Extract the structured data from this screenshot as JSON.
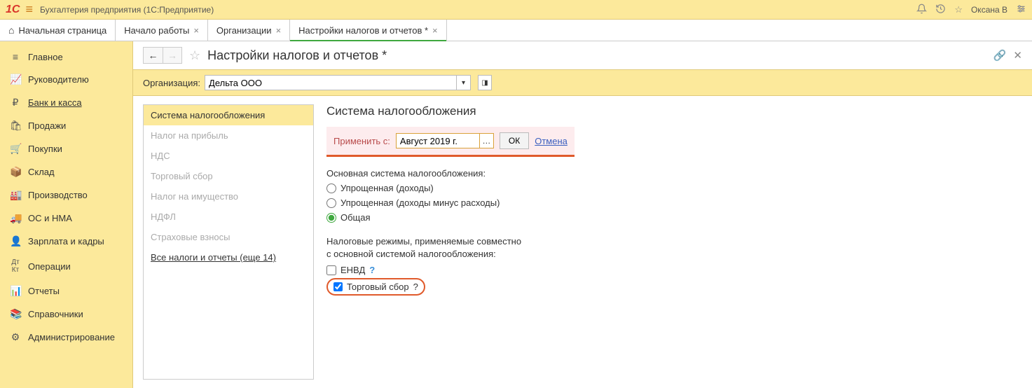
{
  "titlebar": {
    "logo": "1C",
    "title": "Бухгалтерия предприятия  (1С:Предприятие)",
    "user": "Оксана В"
  },
  "tabs": {
    "home": "Начальная страница",
    "t1": "Начало работы",
    "t2": "Организации",
    "t3": "Настройки налогов и отчетов *"
  },
  "sidebar": {
    "items": [
      "Главное",
      "Руководителю",
      "Банк и касса",
      "Продажи",
      "Покупки",
      "Склад",
      "Производство",
      "ОС и НМА",
      "Зарплата и кадры",
      "Операции",
      "Отчеты",
      "Справочники",
      "Администрирование"
    ]
  },
  "toolbar": {
    "page_title": "Настройки налогов и отчетов *"
  },
  "orgbar": {
    "label": "Организация:",
    "value": "Дельта ООО"
  },
  "navpanel": {
    "items": [
      "Система налогообложения",
      "Налог на прибыль",
      "НДС",
      "Торговый сбор",
      "Налог на имущество",
      "НДФЛ",
      "Страховые взносы"
    ],
    "link": "Все налоги и отчеты (еще 14)"
  },
  "form": {
    "heading": "Система налогообложения",
    "apply_label": "Применить с:",
    "apply_value": "Август 2019 г.",
    "ok": "ОК",
    "cancel": "Отмена",
    "main_system_label": "Основная система налогообложения:",
    "radios": {
      "r1": "Упрощенная (доходы)",
      "r2": "Упрощенная (доходы минус расходы)",
      "r3": "Общая"
    },
    "modes_label1": "Налоговые режимы, применяемые совместно",
    "modes_label2": "с основной системой налогообложения:",
    "checks": {
      "c1": "ЕНВД",
      "c2": "Торговый сбор"
    },
    "help": "?"
  }
}
